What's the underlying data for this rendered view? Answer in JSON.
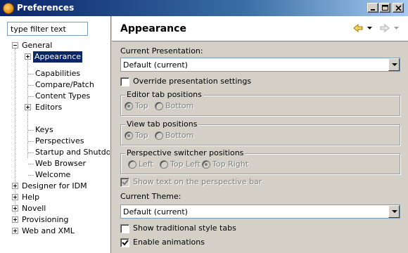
{
  "window": {
    "title": "Preferences"
  },
  "filter": {
    "placeholder": "type filter text"
  },
  "tree": {
    "general": "General",
    "general_children": [
      "Appearance",
      "Capabilities",
      "Compare/Patch",
      "Content Types",
      "Editors",
      "Keys",
      "Perspectives",
      "Startup and Shutdown",
      "Web Browser",
      "Welcome"
    ],
    "top_items": [
      "Designer for IDM",
      "Help",
      "Novell",
      "Provisioning",
      "Web and XML"
    ]
  },
  "page": {
    "title": "Appearance",
    "current_presentation_label": "Current Presentation:",
    "current_presentation_value": "Default (current)",
    "override_label": "Override presentation settings",
    "editor_tab_group": "Editor tab positions",
    "view_tab_group": "View tab positions",
    "top_label": "Top",
    "bottom_label": "Bottom",
    "perspective_switcher_group": "Perspective switcher positions",
    "left_label": "Left",
    "top_left_label": "Top Left",
    "top_right_label": "Top Right",
    "show_text_label": "Show text on the perspective bar",
    "current_theme_label": "Current Theme:",
    "current_theme_value": "Default (current)",
    "traditional_tabs_label": "Show traditional style tabs",
    "enable_animations_label": "Enable animations"
  },
  "state": {
    "override_checked": false,
    "editor_tab_selected": "Top",
    "view_tab_selected": "Top",
    "switcher_selected": "Top Right",
    "show_text_checked": true,
    "traditional_tabs_checked": false,
    "enable_animations_checked": true
  }
}
